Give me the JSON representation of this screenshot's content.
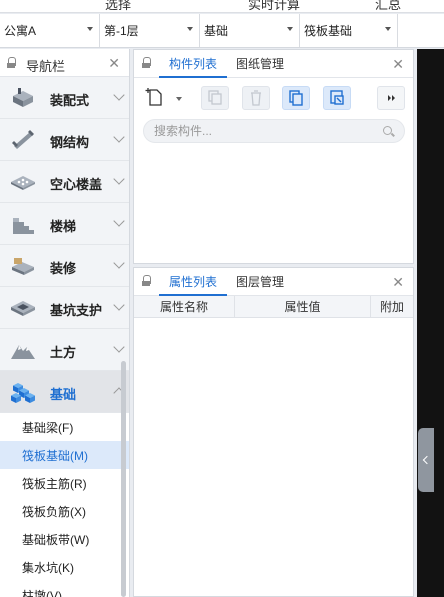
{
  "top_strip": {
    "items": [
      "选择",
      "实时计算",
      "汇总"
    ]
  },
  "selectors": [
    {
      "value": "公寓A"
    },
    {
      "value": "第-1层"
    },
    {
      "value": "基础"
    },
    {
      "value": "筏板基础"
    }
  ],
  "nav": {
    "title": "导航栏",
    "close": "✕",
    "items": [
      {
        "label": "装配式",
        "icon": "prefab-icon"
      },
      {
        "label": "钢结构",
        "icon": "steel-beam-icon"
      },
      {
        "label": "空心楼盖",
        "icon": "hollow-slab-icon"
      },
      {
        "label": "楼梯",
        "icon": "stairs-icon"
      },
      {
        "label": "装修",
        "icon": "decoration-icon"
      },
      {
        "label": "基坑支护",
        "icon": "pit-support-icon"
      },
      {
        "label": "土方",
        "icon": "earthwork-icon"
      },
      {
        "label": "基础",
        "icon": "foundation-icon",
        "active": true
      }
    ],
    "sub_items": [
      {
        "label": "基础梁(F)"
      },
      {
        "label": "筏板基础(M)",
        "selected": true
      },
      {
        "label": "筏板主筋(R)"
      },
      {
        "label": "筏板负筋(X)"
      },
      {
        "label": "基础板带(W)"
      },
      {
        "label": "集水坑(K)"
      },
      {
        "label": "柱墩(V)"
      }
    ]
  },
  "component_panel": {
    "tabs": [
      "构件列表",
      "图纸管理"
    ],
    "close": "✕",
    "search_placeholder": "搜索构件..."
  },
  "property_panel": {
    "tabs": [
      "属性列表",
      "图层管理"
    ],
    "close": "✕",
    "columns": [
      "属性名称",
      "属性值",
      "附加"
    ]
  },
  "colors": {
    "accent": "#1f6fd1",
    "selected_bg": "#dce9fa",
    "right_pane": "#121212"
  }
}
